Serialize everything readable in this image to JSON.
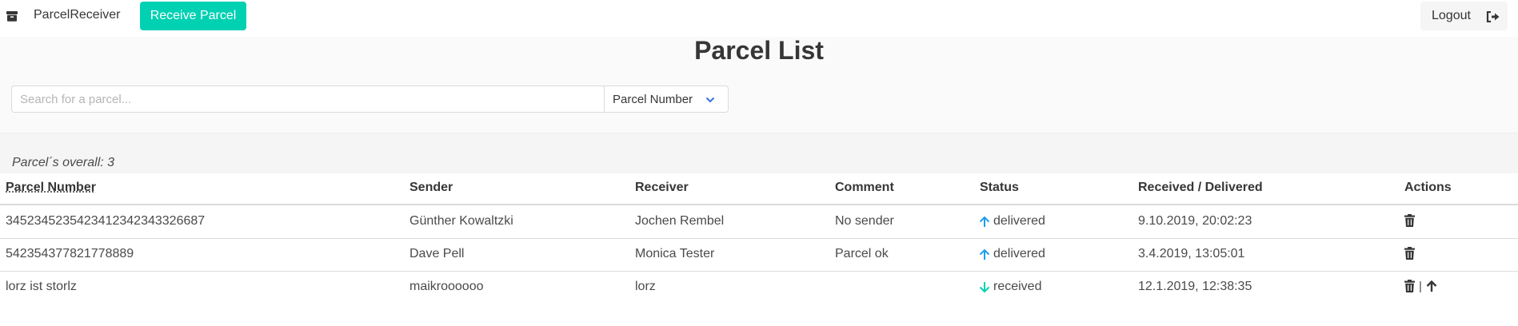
{
  "navbar": {
    "brand": "ParcelReceiver",
    "brand_icon": "box-icon",
    "receive_button": "Receive Parcel",
    "logout_button": "Logout",
    "logout_icon": "sign-out-icon",
    "accent_color": "#00d1b2"
  },
  "hero": {
    "title": "Parcel List",
    "search_placeholder": "Search for a parcel...",
    "search_value": "",
    "filter_selected": "Parcel Number"
  },
  "summary": {
    "count_text": "Parcel´s overall: 3"
  },
  "table": {
    "columns": {
      "parcel_number": "Parcel Number",
      "sender": "Sender",
      "receiver": "Receiver",
      "comment": "Comment",
      "status": "Status",
      "date": "Received / Delivered",
      "actions": "Actions"
    },
    "rows": [
      {
        "parcel_number": "3452345235423412342343326687",
        "sender": "Günther Kowaltzki",
        "receiver": "Jochen Rembel",
        "comment": "No sender",
        "status": "delivered",
        "status_icon": "arrow-up-icon",
        "status_color": "#209cee",
        "date": "9.10.2019, 20:02:23",
        "actions": [
          "trash-icon"
        ]
      },
      {
        "parcel_number": "542354377821778889",
        "sender": "Dave Pell",
        "receiver": "Monica Tester",
        "comment": "Parcel ok",
        "status": "delivered",
        "status_icon": "arrow-up-icon",
        "status_color": "#209cee",
        "date": "3.4.2019, 13:05:01",
        "actions": [
          "trash-icon"
        ]
      },
      {
        "parcel_number": "lorz ist storlz",
        "sender": "maikroooooo",
        "receiver": "lorz",
        "comment": "",
        "status": "received",
        "status_icon": "arrow-down-icon",
        "status_color": "#00d1b2",
        "date": "12.1.2019, 12:38:35",
        "actions": [
          "trash-icon",
          "arrow-up-icon"
        ],
        "actions_separator": "|"
      }
    ]
  }
}
